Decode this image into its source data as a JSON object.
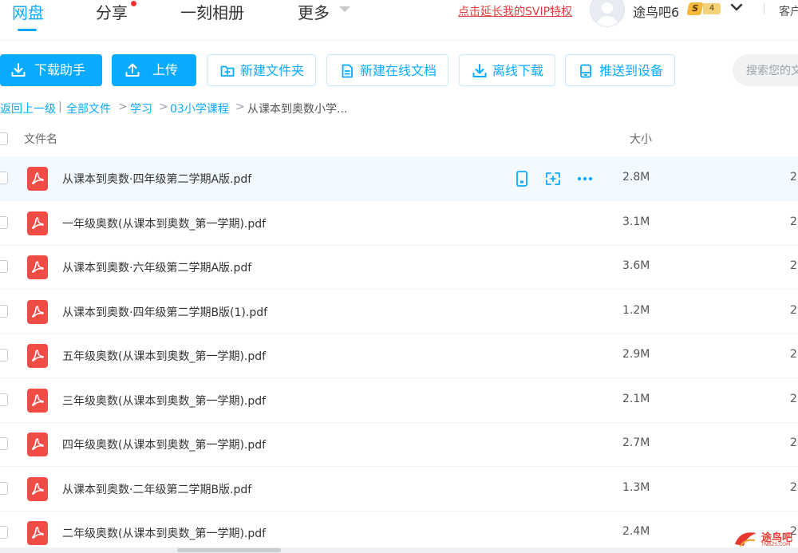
{
  "nav": {
    "tabs": [
      "网盘",
      "分享",
      "一刻相册",
      "更多"
    ],
    "svip_link": "点击延长我的SVIP特权",
    "username": "途鸟吧6",
    "vip_badge_letter": "S",
    "vip_level": "4",
    "client": "客户"
  },
  "toolbar": {
    "download_helper": "下载助手",
    "upload": "上传",
    "new_folder": "新建文件夹",
    "new_online_doc": "新建在线文档",
    "offline_download": "离线下载",
    "push_to_device": "推送到设备",
    "search_placeholder": "搜索您的文件"
  },
  "breadcrumb": {
    "back": "返回上一级",
    "items": [
      "全部文件",
      "学习",
      "03小学课程"
    ],
    "current": "从课本到奥数小学..."
  },
  "table": {
    "columns": {
      "name": "文件名",
      "size": "大小"
    },
    "rows": [
      {
        "name": "从课本到奥数·四年级第二学期A版.pdf",
        "size": "2.8M",
        "extra": "2"
      },
      {
        "name": "一年级奥数(从课本到奥数_第一学期).pdf",
        "size": "3.1M",
        "extra": "2"
      },
      {
        "name": "从课本到奥数·六年级第二学期A版.pdf",
        "size": "3.6M",
        "extra": "2"
      },
      {
        "name": "从课本到奥数·四年级第二学期B版(1).pdf",
        "size": "1.2M",
        "extra": "2"
      },
      {
        "name": "五年级奥数(从课本到奥数_第一学期).pdf",
        "size": "2.9M",
        "extra": "2"
      },
      {
        "name": "三年级奥数(从课本到奥数_第一学期).pdf",
        "size": "2.1M",
        "extra": "2"
      },
      {
        "name": "四年级奥数(从课本到奥数_第一学期).pdf",
        "size": "2.7M",
        "extra": "2"
      },
      {
        "name": "从课本到奥数·二年级第二学期B版.pdf",
        "size": "1.3M",
        "extra": "2"
      },
      {
        "name": "二年级奥数(从课本到奥数_第一学期).pdf",
        "size": "2.4M",
        "extra": "2"
      }
    ]
  },
  "watermark": {
    "text": "途鸟吧",
    "sub": "TNBZS.COM"
  },
  "colors": {
    "accent": "#09aaff",
    "svip_link": "#e23c3c",
    "pdf_icon": "#f04b45"
  },
  "icons": {
    "download_helper": "download-icon",
    "upload": "upload-icon",
    "new_folder": "folder-plus-icon",
    "new_online_doc": "document-icon",
    "offline_download": "download-icon",
    "push_to_device": "device-icon",
    "row_actions": [
      "phone-icon",
      "share-icon",
      "more-icon"
    ]
  }
}
